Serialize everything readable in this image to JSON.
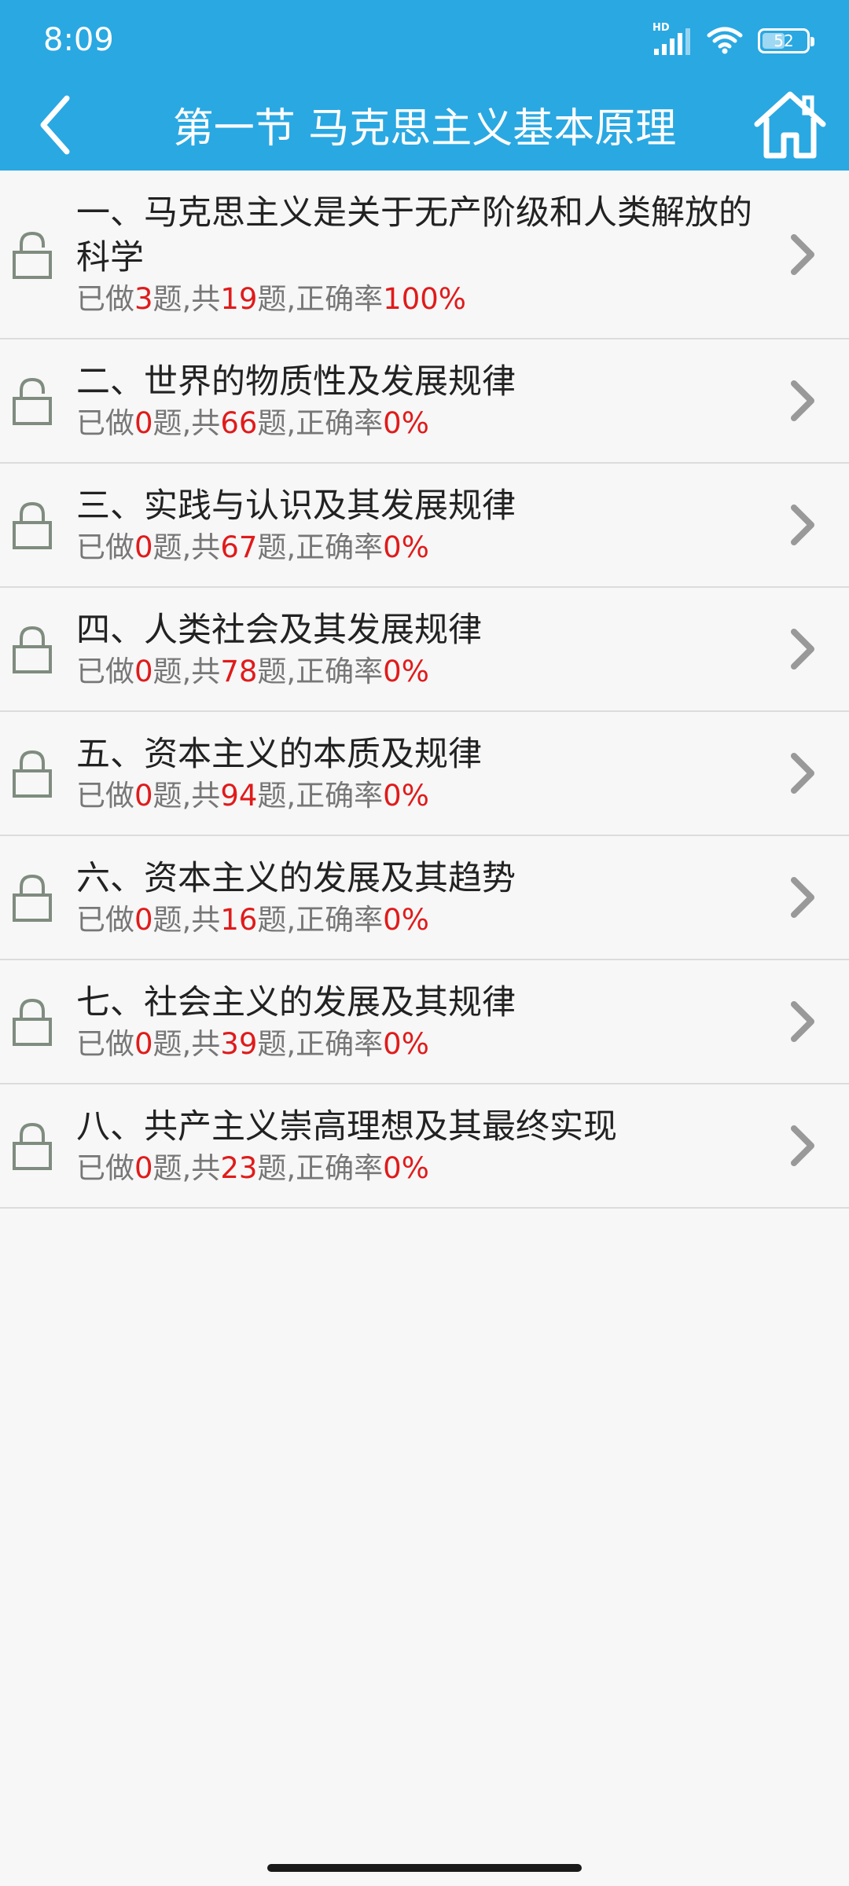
{
  "status": {
    "time": "8:09",
    "network": "HD",
    "battery": "52",
    "battery_level": 0.52
  },
  "nav": {
    "title": "第一节 马克思主义基本原理",
    "back_icon": "chevron-left-icon",
    "home_icon": "home-icon"
  },
  "colors": {
    "header": "#2aa8e2",
    "accent_red": "#e01b1b"
  },
  "meta_labels": {
    "done_prefix": "已做",
    "done_suffix": "题,共",
    "total_suffix": "题,正确率"
  },
  "sections": [
    {
      "title": "一、马克思主义是关于无产阶级和人类解放的科学",
      "done": "3",
      "total": "19",
      "rate": "100%",
      "lock": "unlocked"
    },
    {
      "title": "二、世界的物质性及发展规律",
      "done": "0",
      "total": "66",
      "rate": "0%",
      "lock": "unlocked"
    },
    {
      "title": "三、实践与认识及其发展规律",
      "done": "0",
      "total": "67",
      "rate": "0%",
      "lock": "locked"
    },
    {
      "title": "四、人类社会及其发展规律",
      "done": "0",
      "total": "78",
      "rate": "0%",
      "lock": "locked"
    },
    {
      "title": "五、资本主义的本质及规律",
      "done": "0",
      "total": "94",
      "rate": "0%",
      "lock": "locked"
    },
    {
      "title": "六、资本主义的发展及其趋势",
      "done": "0",
      "total": "16",
      "rate": "0%",
      "lock": "locked"
    },
    {
      "title": "七、社会主义的发展及其规律",
      "done": "0",
      "total": "39",
      "rate": "0%",
      "lock": "locked"
    },
    {
      "title": "八、共产主义崇高理想及其最终实现",
      "done": "0",
      "total": "23",
      "rate": "0%",
      "lock": "locked"
    }
  ]
}
